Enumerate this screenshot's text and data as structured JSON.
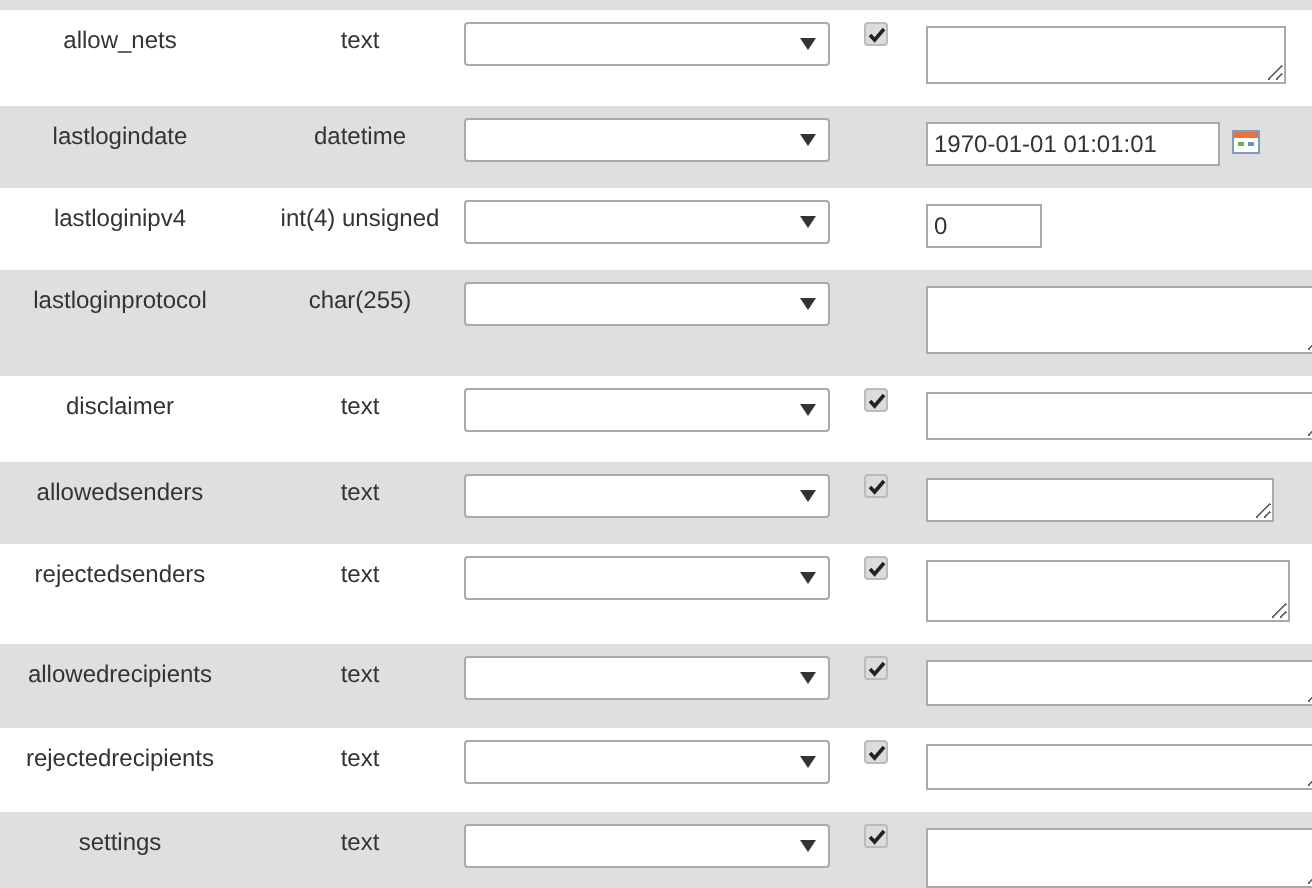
{
  "rows": [
    {
      "column": "allow_nets",
      "type": "text",
      "null": true,
      "value": {
        "kind": "textarea"
      }
    },
    {
      "column": "lastlogindate",
      "type": "datetime",
      "value": {
        "kind": "datetime",
        "value": "1970-01-01 01:01:01"
      }
    },
    {
      "column": "lastloginipv4",
      "type": "int(4) unsigned",
      "value": {
        "kind": "number",
        "value": "0"
      }
    },
    {
      "column": "lastloginprotocol",
      "type": "char(255)",
      "value": {
        "kind": "textarea"
      }
    },
    {
      "column": "disclaimer",
      "type": "text",
      "null": true,
      "value": {
        "kind": "textarea"
      }
    },
    {
      "column": "allowedsenders",
      "type": "text",
      "null": true,
      "value": {
        "kind": "textarea"
      }
    },
    {
      "column": "rejectedsenders",
      "type": "text",
      "null": true,
      "value": {
        "kind": "textarea"
      }
    },
    {
      "column": "allowedrecipients",
      "type": "text",
      "null": true,
      "value": {
        "kind": "textarea"
      }
    },
    {
      "column": "rejectedrecipients",
      "type": "text",
      "null": true,
      "value": {
        "kind": "textarea"
      }
    },
    {
      "column": "settings",
      "type": "text",
      "null": true,
      "value": {
        "kind": "textarea"
      }
    }
  ]
}
